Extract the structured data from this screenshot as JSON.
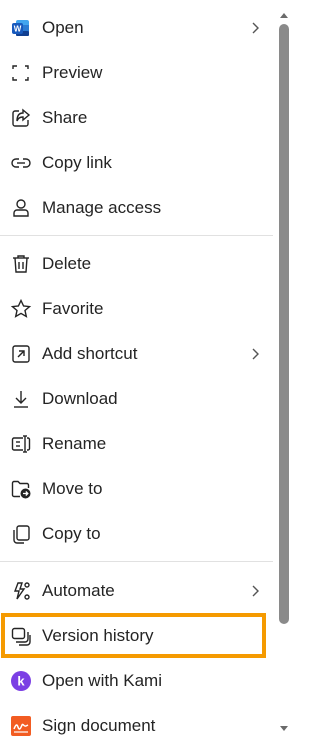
{
  "menu": {
    "items": [
      {
        "label": "Open",
        "icon": "word-icon",
        "submenu": true
      },
      {
        "label": "Preview",
        "icon": "preview-icon",
        "submenu": false
      },
      {
        "label": "Share",
        "icon": "share-icon",
        "submenu": false
      },
      {
        "label": "Copy link",
        "icon": "link-icon",
        "submenu": false
      },
      {
        "label": "Manage access",
        "icon": "person-icon",
        "submenu": false
      },
      {
        "label": "Delete",
        "icon": "trash-icon",
        "submenu": false
      },
      {
        "label": "Favorite",
        "icon": "star-icon",
        "submenu": false
      },
      {
        "label": "Add shortcut",
        "icon": "shortcut-icon",
        "submenu": true
      },
      {
        "label": "Download",
        "icon": "download-icon",
        "submenu": false
      },
      {
        "label": "Rename",
        "icon": "rename-icon",
        "submenu": false
      },
      {
        "label": "Move to",
        "icon": "move-folder-icon",
        "submenu": false
      },
      {
        "label": "Copy to",
        "icon": "copy-icon",
        "submenu": false
      },
      {
        "label": "Automate",
        "icon": "automate-icon",
        "submenu": true
      },
      {
        "label": "Version history",
        "icon": "version-history-icon",
        "submenu": false,
        "highlighted": true
      },
      {
        "label": "Open with Kami",
        "icon": "kami-icon",
        "submenu": false
      },
      {
        "label": "Sign document",
        "icon": "sign-document-icon",
        "submenu": false
      }
    ]
  },
  "colors": {
    "highlight_border": "#f59a00",
    "word_blue": "#185abd",
    "kami_purple": "#7b3fe4",
    "sign_orange": "#f25c22"
  }
}
